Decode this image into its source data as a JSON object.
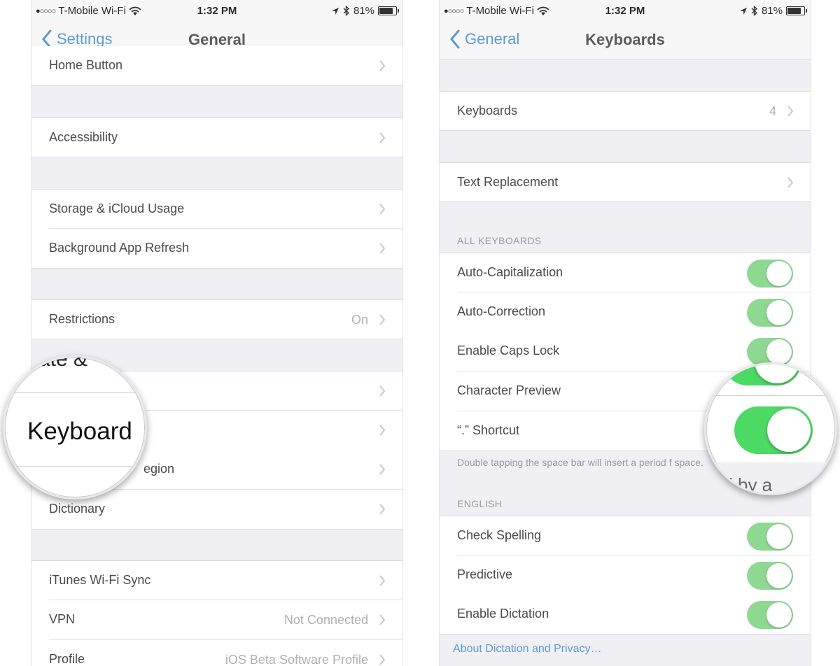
{
  "colors": {
    "accent": "#5e9ad6",
    "toggle_on": "#8fd892",
    "toggle_on_magnified": "#4cd964",
    "background": "#efeff4"
  },
  "status_bar": {
    "carrier": "T-Mobile Wi-Fi",
    "time": "1:32 PM",
    "battery": "81%",
    "battery_level": 0.81
  },
  "left": {
    "nav": {
      "back_label": "Settings",
      "title": "General"
    },
    "rows": [
      {
        "label": "Home Button",
        "value": ""
      },
      {
        "label": "Accessibility",
        "value": ""
      },
      {
        "label": "Storage & iCloud Usage",
        "value": ""
      },
      {
        "label": "Background App Refresh",
        "value": ""
      },
      {
        "label": "Restrictions",
        "value": "On"
      },
      {
        "label": "",
        "value": ""
      },
      {
        "label": "",
        "value": ""
      },
      {
        "label": "egion",
        "value": ""
      },
      {
        "label": "Dictionary",
        "value": ""
      },
      {
        "label": "iTunes Wi-Fi Sync",
        "value": ""
      },
      {
        "label": "VPN",
        "value": "Not Connected"
      },
      {
        "label": "Profile",
        "value": "iOS Beta Software Profile"
      }
    ],
    "magnifier": {
      "partial_top": "ate &",
      "label": "Keyboard"
    }
  },
  "right": {
    "nav": {
      "back_label": "General",
      "title": "Keyboards"
    },
    "keyboards_row": {
      "label": "Keyboards",
      "value": "4"
    },
    "text_replacement": {
      "label": "Text Replacement"
    },
    "all_keyboards": {
      "header": "ALL KEYBOARDS",
      "rows": [
        {
          "label": "Auto-Capitalization",
          "on": true
        },
        {
          "label": "Auto-Correction",
          "on": true
        },
        {
          "label": "Enable Caps Lock",
          "on": true
        },
        {
          "label": "Character Preview",
          "on": true
        },
        {
          "label": "“.” Shortcut",
          "on": true
        }
      ],
      "footer": "Double tapping the space bar will insert a period f space."
    },
    "english": {
      "header": "ENGLISH",
      "rows": [
        {
          "label": "Check Spelling",
          "on": true
        },
        {
          "label": "Predictive",
          "on": true
        },
        {
          "label": "Enable Dictation",
          "on": true
        }
      ]
    },
    "dictation_link": "About Dictation and Privacy…",
    "magnifier": {
      "text": "l by a"
    }
  }
}
